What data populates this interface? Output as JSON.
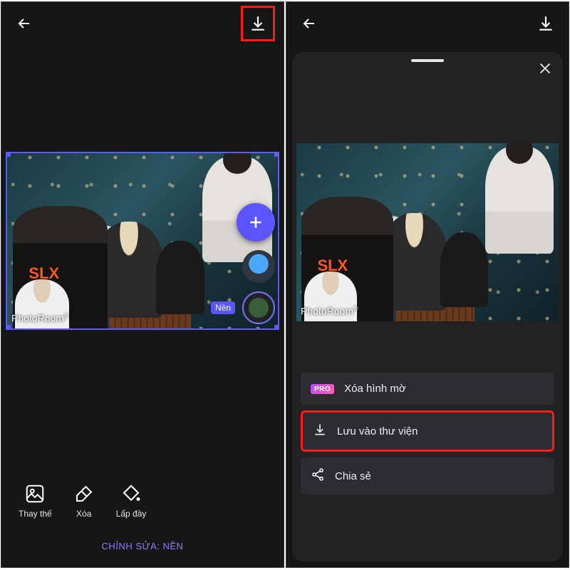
{
  "left": {
    "watermark": "PhotoRoom",
    "tools": {
      "replace": "Thay thế",
      "delete": "Xóa",
      "fill": "Lấp đầy"
    },
    "mode_label": "CHỈNH SỬA: NỀN",
    "layer_label": "Nền",
    "shirt_text": "SLX"
  },
  "right": {
    "watermark": "PhotoRoom",
    "pro_badge": "PRO",
    "options": {
      "remove_watermark": "Xóa hình mờ",
      "save_gallery": "Lưu vào thư viện",
      "share": "Chia sẻ"
    }
  }
}
